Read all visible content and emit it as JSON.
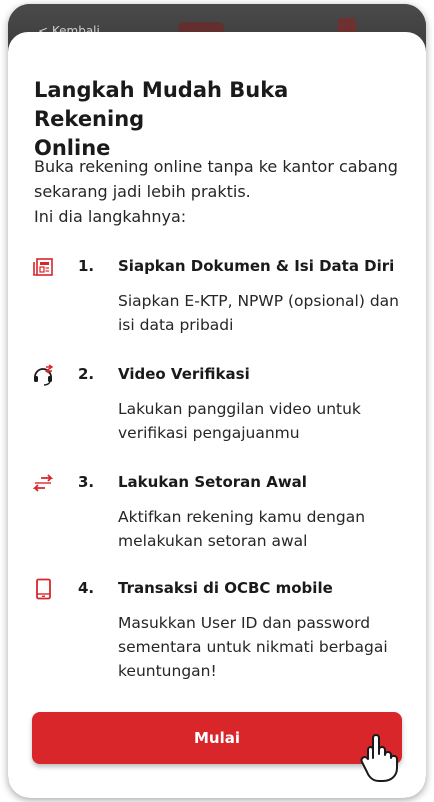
{
  "back_label": "< Kembali",
  "title": "Langkah Mudah Buka Rekening Online",
  "title_lines": [
    "Langkah Mudah Buka Rekening",
    "Online"
  ],
  "intro_lines": [
    "Buka rekening online tanpa ke kantor cabang",
    "sekarang jadi lebih praktis.",
    "Ini dia langkahnya:"
  ],
  "steps": [
    {
      "num": "1.",
      "head": "Siapkan Dokumen & Isi Data Diri",
      "desc_lines": [
        "Siapkan E-KTP, NPWP (opsional) dan",
        "isi data pribadi"
      ],
      "icon": "document-icon"
    },
    {
      "num": "2.",
      "head": "Video Verifikasi",
      "desc_lines": [
        "Lakukan panggilan video untuk",
        "verifikasi pengajuanmu"
      ],
      "icon": "headset-icon"
    },
    {
      "num": "3.",
      "head": "Lakukan Setoran Awal",
      "desc_lines": [
        "Aktifkan rekening kamu dengan",
        "melakukan setoran awal"
      ],
      "icon": "transfer-arrows-icon"
    },
    {
      "num": "4.",
      "head": "Transaksi di OCBC mobile",
      "desc_lines": [
        "Masukkan User ID dan password",
        "sementara untuk nikmati berbagai",
        "keuntungan!"
      ],
      "icon": "mobile-phone-icon"
    }
  ],
  "cta_label": "Mulai",
  "colors": {
    "accent": "#d8262b",
    "text": "#1a1a1a",
    "background_dim": "#3a3a3a"
  }
}
